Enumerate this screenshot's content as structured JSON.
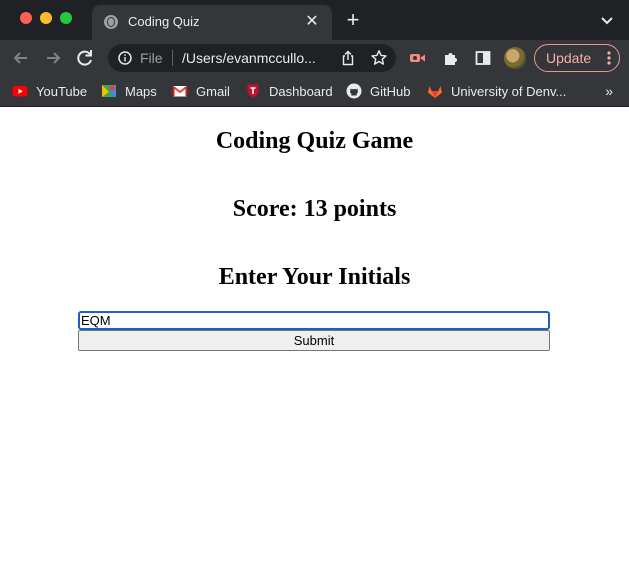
{
  "browser": {
    "tab": {
      "title": "Coding Quiz",
      "close_glyph": "✕"
    },
    "new_tab_glyph": "+",
    "omnibox": {
      "scheme_label": "File",
      "url": "/Users/evanmccullo..."
    },
    "update_button": {
      "label": "Update",
      "color": "#f6aea9"
    },
    "bookmarks": [
      {
        "label": "YouTube",
        "icon": "youtube-icon"
      },
      {
        "label": "Maps",
        "icon": "maps-icon"
      },
      {
        "label": "Gmail",
        "icon": "gmail-icon"
      },
      {
        "label": "Dashboard",
        "icon": "dashboard-icon"
      },
      {
        "label": "GitHub",
        "icon": "github-icon"
      },
      {
        "label": "University of Denv...",
        "icon": "gitlab-icon"
      }
    ],
    "bookmarks_more_glyph": "»"
  },
  "page": {
    "title": "Coding Quiz Game",
    "score_text": "Score: 13 points",
    "prompt": "Enter Your Initials",
    "initials_input": {
      "value": "EQM"
    },
    "submit_label": "Submit"
  },
  "colors": {
    "tab_strip": "#202124",
    "toolbar": "#35363a",
    "input_focus": "#1f5fc2"
  }
}
